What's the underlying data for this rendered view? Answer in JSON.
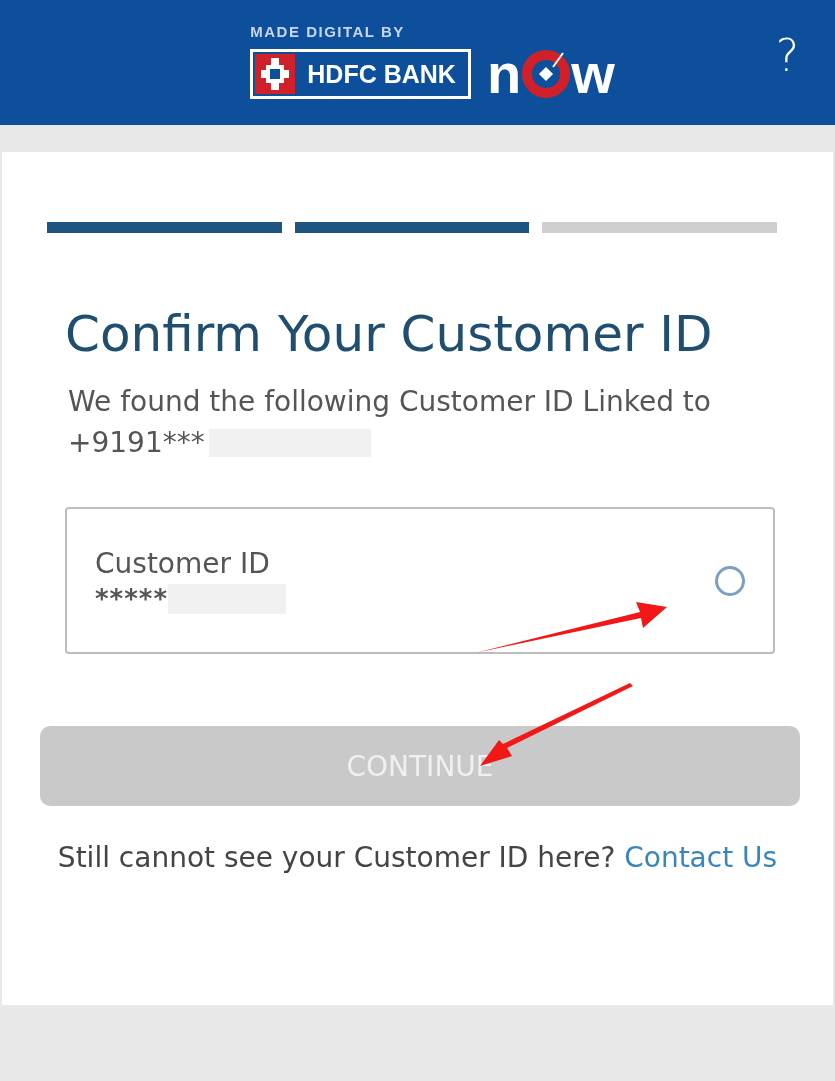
{
  "header": {
    "tagline": "MADE DIGITAL BY",
    "bank": "HDFC BANK",
    "product_left": "n",
    "product_right": "w",
    "help": "?"
  },
  "progress": [
    {
      "done": true
    },
    {
      "done": true
    },
    {
      "done": false
    }
  ],
  "title": "Confirm Your Customer ID",
  "message": "We found the following Customer ID Linked to",
  "phone": "+9191***",
  "option": {
    "label": "Customer ID",
    "value": "*****",
    "selected": false
  },
  "continue": {
    "label": "CONTINUE",
    "disabled": true
  },
  "footer": {
    "text": "Still cannot see your Customer ID here?",
    "link": "Contact Us"
  }
}
